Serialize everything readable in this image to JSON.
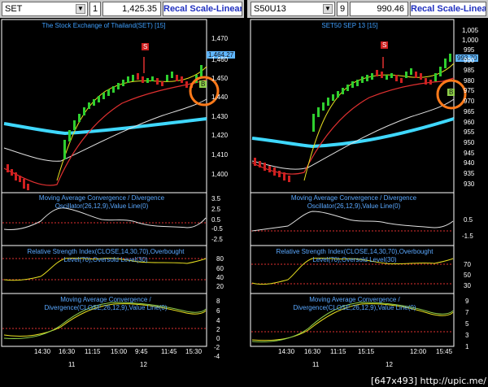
{
  "left": {
    "symbol": "SET",
    "count": "1",
    "price": "1,425.35",
    "recal": "Recal Scale-Linear",
    "title": "The Stock Exchange of Thailand(SET) [15]",
    "last_price_badge": "1,464.27",
    "signal_s": "S",
    "signal_b": "B",
    "price_axis": [
      "1,470",
      "1,460",
      "1,450",
      "1,440",
      "1,430",
      "1,420",
      "1,410",
      "1,400"
    ],
    "macd1_label": "Moving Average Convergence / Divergence Oscillator(26,12,9),Value Line(0)",
    "macd1_axis": [
      "3.5",
      "2.5",
      "0.5",
      "-0.5",
      "-2.5"
    ],
    "rsi_label": "Relative Strength Index(CLOSE,14,30,70),Overbought Level(70),Oversold Level(30)",
    "rsi_axis": [
      "80",
      "60",
      "40",
      "20"
    ],
    "macd2_label": "Moving Average Convergence / Divergence(CLOSE,26,12,9),Value Line(0)",
    "macd2_axis": [
      "8",
      "6",
      "4",
      "2",
      "0",
      "-2",
      "-4"
    ],
    "times": [
      "14:30",
      "16:30",
      "11:15",
      "15:00",
      "9:45",
      "11:45",
      "15:30"
    ],
    "days": [
      "11",
      "12"
    ]
  },
  "right": {
    "symbol": "S50U13",
    "count": "9",
    "price": "990.46",
    "recal": "Recal Scale-Linear",
    "title": "SET50 SEP 13   [15]",
    "last_price_badge": "993.70",
    "signal_s": "S",
    "signal_b": "B",
    "price_axis": [
      "1,005",
      "1,000",
      "995",
      "990",
      "985",
      "980",
      "975",
      "970",
      "965",
      "960",
      "955",
      "950",
      "945",
      "940",
      "935",
      "930"
    ],
    "macd1_label": "Moving Average Convergence / Divergence Oscillator(26,12,9),Value Line(0)",
    "macd1_axis": [
      "0.5",
      "-1.5"
    ],
    "rsi_label": "Relative Strength Index(CLOSE,14,30,70),Overbought Level(70),Oversold Level(30)",
    "rsi_axis": [
      "70",
      "50",
      "30"
    ],
    "macd2_label": "Moving Average Convergence / Divergence(CLOSE,26,12,9),Value Line(0)",
    "macd2_axis": [
      "9",
      "7",
      "5",
      "3",
      "1"
    ],
    "times": [
      "14:30",
      "16:30",
      "11:15",
      "15:15",
      "12:00",
      "15:45"
    ],
    "days": [
      "11",
      "12"
    ]
  },
  "watermark": "[647x493] http://upic.me/",
  "colors": {
    "accent_blue": "#3fa0ff",
    "highlight_circle": "#ff7a1a",
    "ma_cyan": "#3fd8ff",
    "ma_white": "#f0f0f0",
    "ma_red": "#e03030",
    "ma_yellow": "#e8e020",
    "up_green": "#2fcf2f",
    "down_red": "#d02020"
  }
}
